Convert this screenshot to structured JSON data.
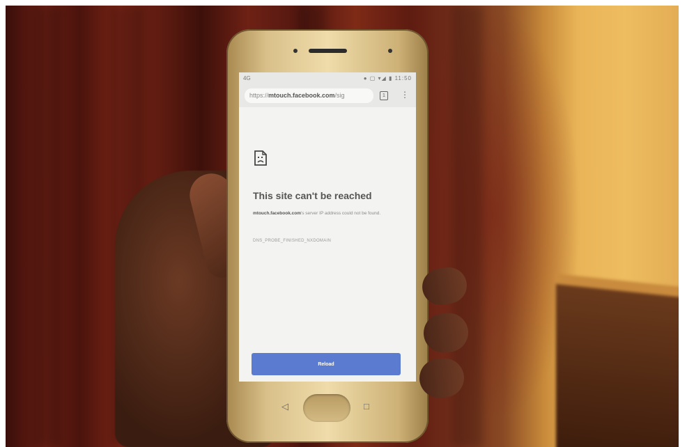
{
  "scene": {
    "type": "photo-hand-holding-smartphone",
    "colors": {
      "curtain": "#6b1f14",
      "wall": "#eebd60",
      "reload_button": "#5b7bd1"
    }
  },
  "phone": {
    "status": {
      "left": "4G",
      "right": "● ▢ ▾◢ ▮ 11:50"
    },
    "browser": {
      "url_prefix": "https://",
      "url_domain": "mtouch.facebook.com",
      "url_suffix": "/sig",
      "tabs_count": "1",
      "menu_icon": "more-vert-icon"
    },
    "error": {
      "icon": "sad-page-icon",
      "title": "This site can't be reached",
      "domain": "mtouch.facebook.com",
      "message_tail": "'s server IP address could not be found.",
      "code": "DNS_PROBE_FINISHED_NXDOMAIN"
    },
    "reload_label": "Reload",
    "nav": {
      "back": "◁",
      "home": "○",
      "recent": "□"
    }
  }
}
